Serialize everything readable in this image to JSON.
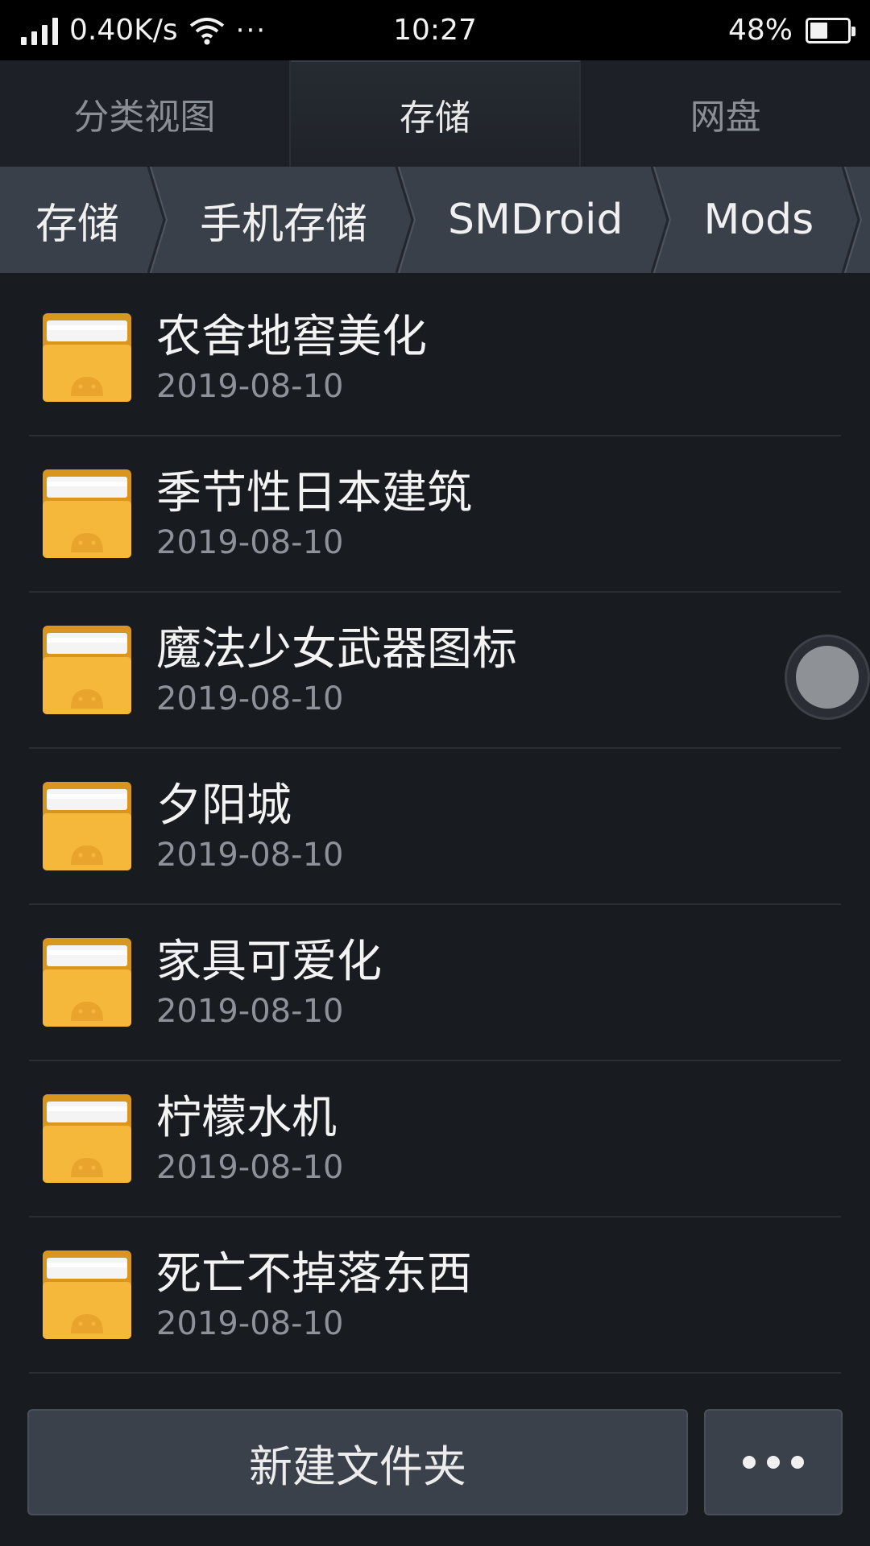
{
  "status_bar": {
    "speed": "0.40K/s",
    "dots": "···",
    "time": "10:27",
    "battery": "48%",
    "battery_level": 0.48
  },
  "tabs": [
    {
      "label": "分类视图",
      "active": false
    },
    {
      "label": "存储",
      "active": true
    },
    {
      "label": "网盘",
      "active": false
    }
  ],
  "breadcrumb": [
    {
      "label": "存储"
    },
    {
      "label": "手机存储"
    },
    {
      "label": "SMDroid"
    },
    {
      "label": "Mods"
    }
  ],
  "files": [
    {
      "name": "农舍地窖美化",
      "date": "2019-08-10"
    },
    {
      "name": "季节性日本建筑",
      "date": "2019-08-10"
    },
    {
      "name": "魔法少女武器图标",
      "date": "2019-08-10"
    },
    {
      "name": "夕阳城",
      "date": "2019-08-10"
    },
    {
      "name": "家具可爱化",
      "date": "2019-08-10"
    },
    {
      "name": "柠檬水机",
      "date": "2019-08-10"
    },
    {
      "name": "死亡不掉落东西",
      "date": "2019-08-10"
    }
  ],
  "bottom_bar": {
    "new_folder_label": "新建文件夹"
  },
  "colors": {
    "background": "#181b20",
    "breadcrumb_bg": "#3a404a",
    "folder_yellow": "#f6b83a",
    "folder_dark": "#d9961f"
  }
}
